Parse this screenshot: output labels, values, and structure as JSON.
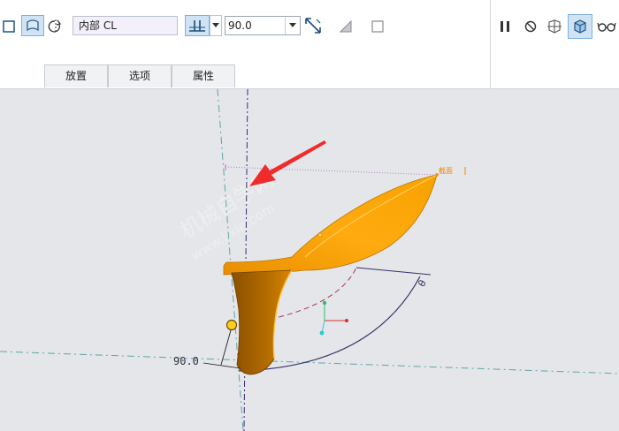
{
  "toolbar": {
    "reference_value": "内部 CL",
    "angle_value": "90.0"
  },
  "tabs": [
    {
      "label": "放置"
    },
    {
      "label": "选项"
    },
    {
      "label": "属性"
    }
  ],
  "viewport": {
    "dimension_label": "90.0",
    "datum_label": "截面",
    "angle_marker": "θ",
    "watermark_main": "机械自学网",
    "watermark_url": "www.jixie.com"
  },
  "colors": {
    "surface": "#f5a000",
    "surface_dark": "#a86200",
    "arrow": "#f02b2b",
    "viewport_bg": "#e5e6e9",
    "active_button_bg": "#cfe3f4"
  }
}
